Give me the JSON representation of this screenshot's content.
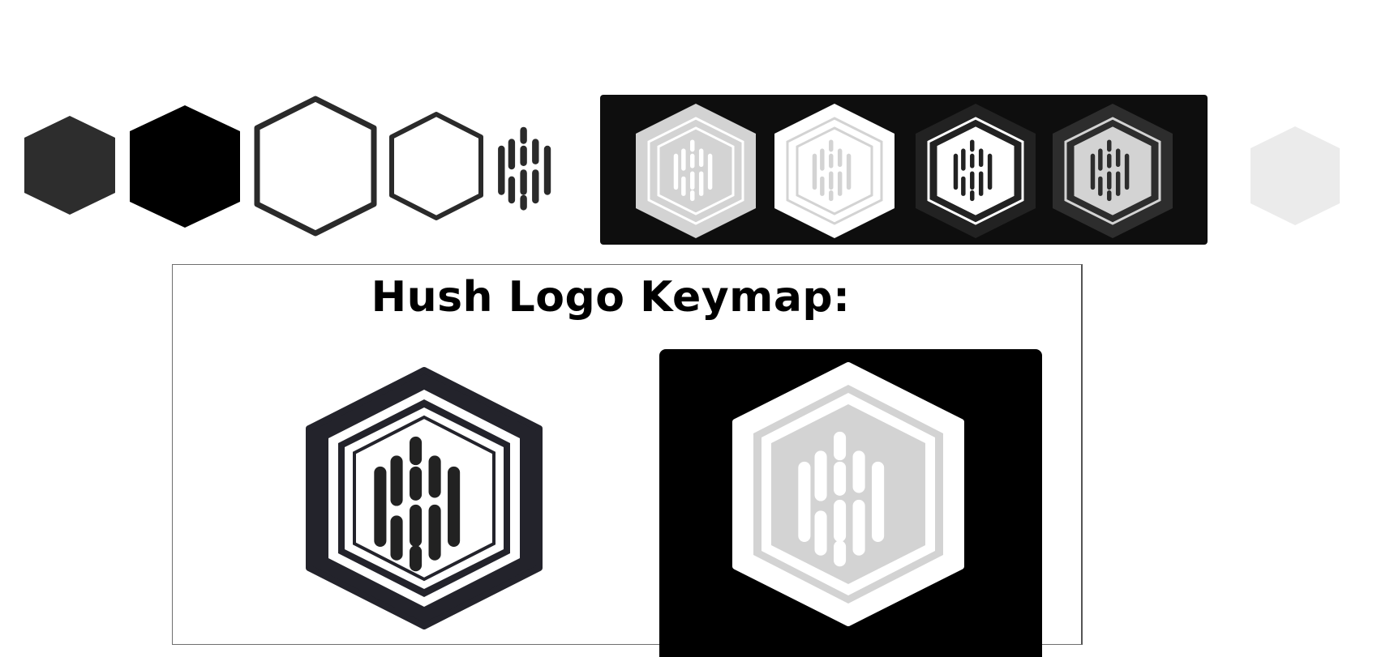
{
  "keymap": {
    "title": "Hush Logo Keymap:"
  },
  "icons": {
    "row": [
      "filled-hexagon-dark-gray-icon",
      "filled-hexagon-black-icon",
      "outline-hexagon-large-icon",
      "outline-hexagon-small-icon",
      "hush-bars-glyph-icon",
      "hush-logo-light-gray-icon",
      "hush-logo-white-icon",
      "hush-logo-dark-icon",
      "hush-logo-charcoal-icon",
      "filled-hexagon-light-gray-icon"
    ],
    "keymap": [
      "hush-logo-navy-icon",
      "hush-logo-white-on-black-icon"
    ]
  },
  "colors": {
    "page_background": "#ffffff",
    "dark_gray": "#2d2d2d",
    "black": "#000000",
    "outline": "#2a2a2a",
    "strip_background": "#0e0e0e",
    "light_gray": "#d3d3d3",
    "pale_gray": "#ebebeb",
    "white": "#ffffff",
    "navy": "#23232b",
    "logo_charcoal": "#222222",
    "card_border": "#6f6f6f"
  }
}
